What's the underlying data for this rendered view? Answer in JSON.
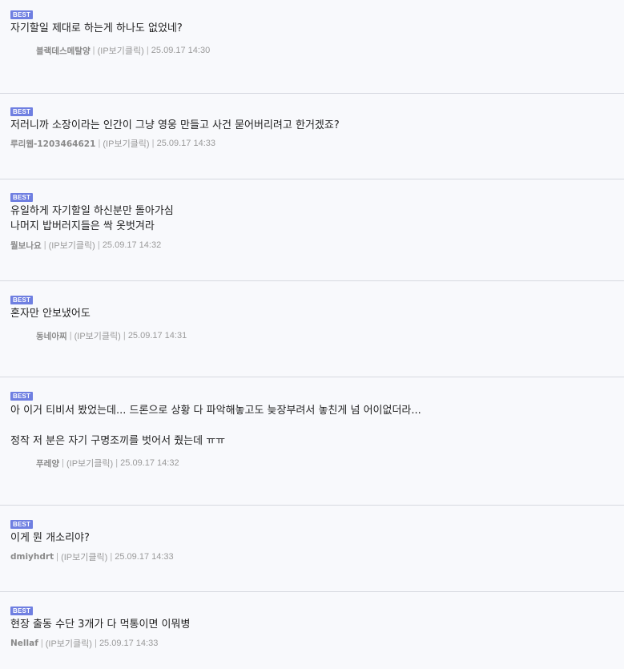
{
  "badge_label": "BEST",
  "separator": " | ",
  "comments": [
    {
      "text": "자기할일 제대로 하는게 하나도 없었네?",
      "author": "블랙데스메탈양",
      "ip_label": "(IP보기클릭)",
      "date": "25.09.17 14:30"
    },
    {
      "text": "저러니까 소장이라는 인간이 그냥 영웅 만들고 사건 묻어버리려고 한거겠죠?",
      "author": "루리웹-1203464621",
      "ip_label": "(IP보기클릭)",
      "date": "25.09.17 14:33"
    },
    {
      "text": "유일하게 자기할일 하신분만 돌아가심\n나머지 밥버러지들은 싹 옷벗겨라",
      "author": "뭘보나요",
      "ip_label": "(IP보기클릭)",
      "date": "25.09.17 14:32"
    },
    {
      "text": "혼자만 안보냈어도",
      "author": "동네아찌",
      "ip_label": "(IP보기클릭)",
      "date": "25.09.17 14:31"
    },
    {
      "text": "아 이거 티비서 봤었는데... 드론으로 상황 다 파악해놓고도 늦장부려서 놓친게 넘 어이없더라...\n\n정작 저 분은 자기 구명조끼를 벗어서 줬는데 ㅠㅠ",
      "author": "푸레양",
      "ip_label": "(IP보기클릭)",
      "date": "25.09.17 14:32"
    },
    {
      "text": "이게 뭔 개소리야?",
      "author": "dmiyhdrt",
      "ip_label": "(IP보기클릭)",
      "date": "25.09.17 14:33"
    },
    {
      "text": "현장 출동 수단 3개가 다 먹통이면 이뭐병",
      "author": "Nellaf",
      "ip_label": "(IP보기클릭)",
      "date": "25.09.17 14:33"
    }
  ]
}
